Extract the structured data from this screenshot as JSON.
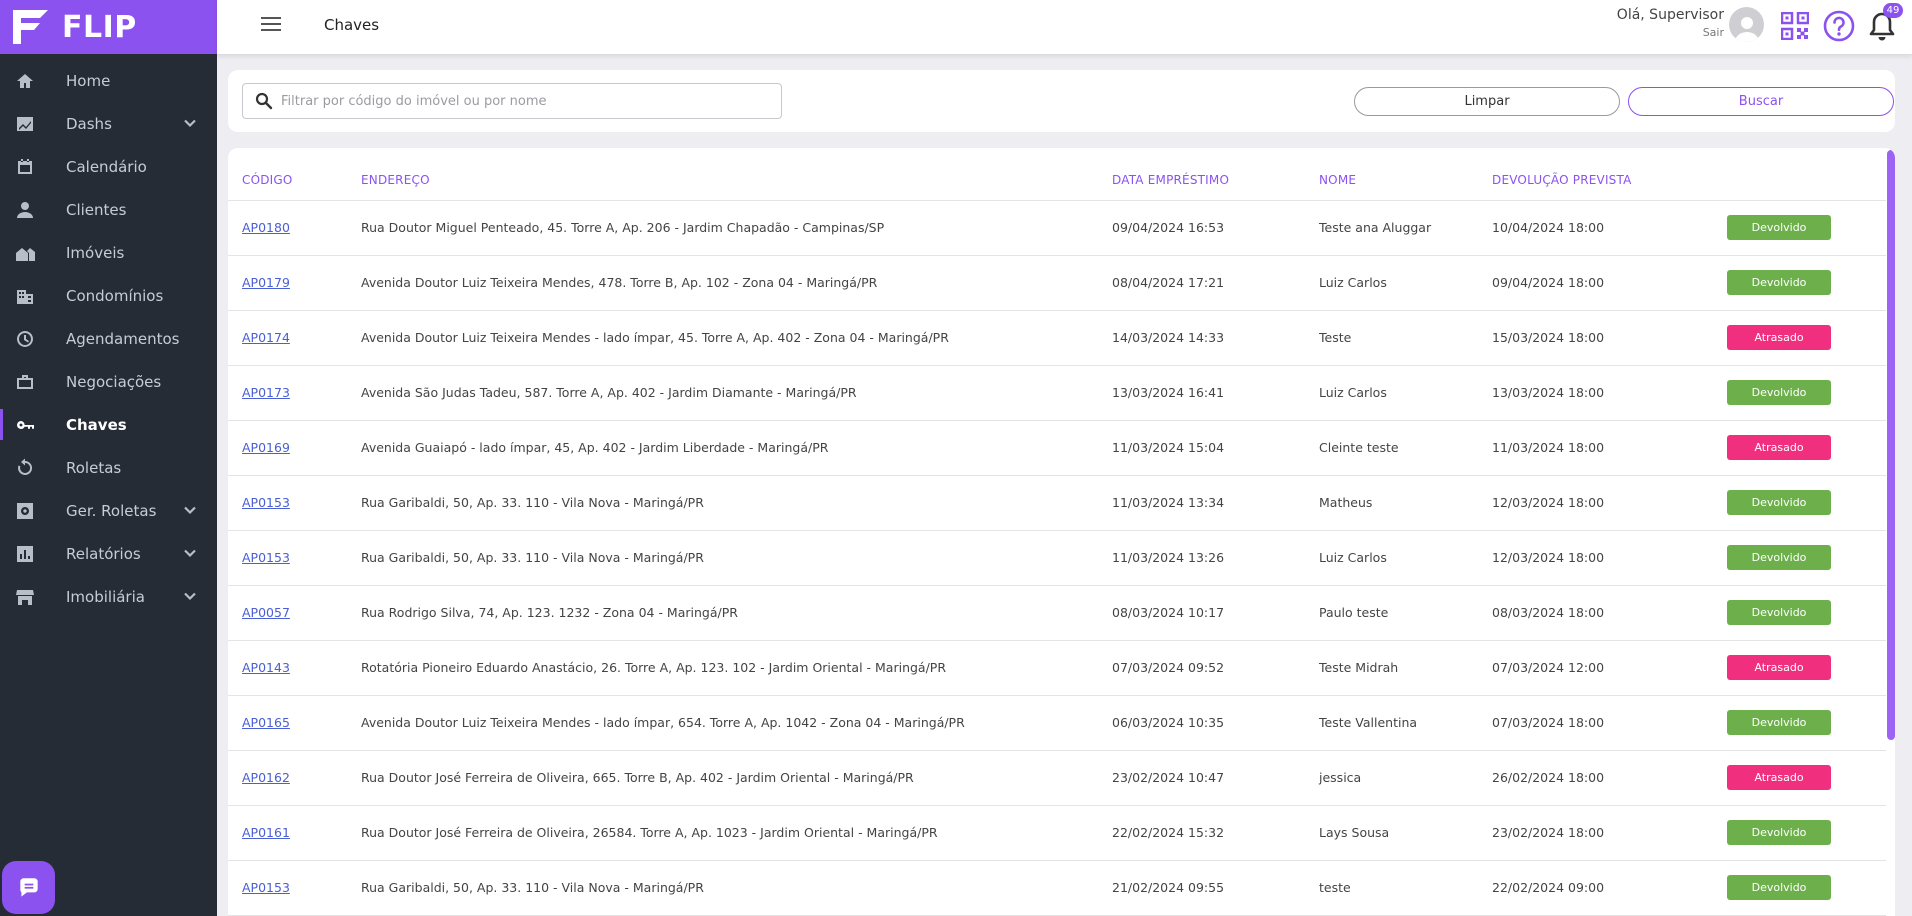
{
  "app": {
    "brand": "FLIP"
  },
  "sidebar": {
    "items": [
      {
        "label": "Home",
        "icon": "home-icon",
        "expandable": false
      },
      {
        "label": "Dashs",
        "icon": "chart-line-icon",
        "expandable": true
      },
      {
        "label": "Calendário",
        "icon": "calendar-icon",
        "expandable": false
      },
      {
        "label": "Clientes",
        "icon": "person-icon",
        "expandable": false
      },
      {
        "label": "Imóveis",
        "icon": "houses-icon",
        "expandable": false
      },
      {
        "label": "Condomínios",
        "icon": "building-icon",
        "expandable": false
      },
      {
        "label": "Agendamentos",
        "icon": "clock-icon",
        "expandable": false
      },
      {
        "label": "Negociações",
        "icon": "briefcase-icon",
        "expandable": false
      },
      {
        "label": "Chaves",
        "icon": "key-icon",
        "expandable": false,
        "active": true
      },
      {
        "label": "Roletas",
        "icon": "rotate-icon",
        "expandable": false
      },
      {
        "label": "Ger. Roletas",
        "icon": "settings-box-icon",
        "expandable": true
      },
      {
        "label": "Relatórios",
        "icon": "bar-chart-icon",
        "expandable": true
      },
      {
        "label": "Imobiliária",
        "icon": "store-icon",
        "expandable": true
      }
    ]
  },
  "topbar": {
    "title": "Chaves",
    "greeting": "Olá, Supervisor",
    "logout": "Sair",
    "notifications": "49"
  },
  "filter": {
    "placeholder": "Filtrar por código do imóvel ou por nome",
    "clear_label": "Limpar",
    "search_label": "Buscar"
  },
  "table": {
    "headers": [
      "CÓDIGO",
      "ENDEREÇO",
      "DATA EMPRÉSTIMO",
      "NOME",
      "DEVOLUÇÃO PREVISTA",
      ""
    ],
    "rows": [
      {
        "code": "AP0180",
        "address": "Rua Doutor Miguel Penteado, 45. Torre A, Ap. 206 - Jardim Chapadão - Campinas/SP",
        "loan_date": "09/04/2024 16:53",
        "name": "Teste ana Aluggar",
        "due_date": "10/04/2024 18:00",
        "status": "Devolvido"
      },
      {
        "code": "AP0179",
        "address": "Avenida Doutor Luiz Teixeira Mendes, 478. Torre B, Ap. 102 - Zona 04 - Maringá/PR",
        "loan_date": "08/04/2024 17:21",
        "name": "Luiz Carlos",
        "due_date": "09/04/2024 18:00",
        "status": "Devolvido"
      },
      {
        "code": "AP0174",
        "address": "Avenida Doutor Luiz Teixeira Mendes - lado ímpar, 45. Torre A, Ap. 402 - Zona 04 - Maringá/PR",
        "loan_date": "14/03/2024 14:33",
        "name": "Teste",
        "due_date": "15/03/2024 18:00",
        "status": "Atrasado"
      },
      {
        "code": "AP0173",
        "address": "Avenida São Judas Tadeu, 587. Torre A, Ap. 402 - Jardim Diamante - Maringá/PR",
        "loan_date": "13/03/2024 16:41",
        "name": "Luiz Carlos",
        "due_date": "13/03/2024 18:00",
        "status": "Devolvido"
      },
      {
        "code": "AP0169",
        "address": "Avenida Guaiapó - lado ímpar, 45, Ap. 402 - Jardim Liberdade - Maringá/PR",
        "loan_date": "11/03/2024 15:04",
        "name": "Cleinte teste",
        "due_date": "11/03/2024 18:00",
        "status": "Atrasado"
      },
      {
        "code": "AP0153",
        "address": "Rua Garibaldi, 50, Ap. 33. 110 - Vila Nova - Maringá/PR",
        "loan_date": "11/03/2024 13:34",
        "name": "Matheus",
        "due_date": "12/03/2024 18:00",
        "status": "Devolvido"
      },
      {
        "code": "AP0153",
        "address": "Rua Garibaldi, 50, Ap. 33. 110 - Vila Nova - Maringá/PR",
        "loan_date": "11/03/2024 13:26",
        "name": "Luiz Carlos",
        "due_date": "12/03/2024 18:00",
        "status": "Devolvido"
      },
      {
        "code": "AP0057",
        "address": "Rua Rodrigo Silva, 74, Ap. 123. 1232 - Zona 04 - Maringá/PR",
        "loan_date": "08/03/2024 10:17",
        "name": "Paulo teste",
        "due_date": "08/03/2024 18:00",
        "status": "Devolvido"
      },
      {
        "code": "AP0143",
        "address": "Rotatória Pioneiro Eduardo Anastácio, 26. Torre A, Ap. 123. 102 - Jardim Oriental - Maringá/PR",
        "loan_date": "07/03/2024 09:52",
        "name": "Teste Midrah",
        "due_date": "07/03/2024 12:00",
        "status": "Atrasado"
      },
      {
        "code": "AP0165",
        "address": "Avenida Doutor Luiz Teixeira Mendes - lado ímpar, 654. Torre A, Ap. 1042 - Zona 04 - Maringá/PR",
        "loan_date": "06/03/2024 10:35",
        "name": "Teste Vallentina",
        "due_date": "07/03/2024 18:00",
        "status": "Devolvido"
      },
      {
        "code": "AP0162",
        "address": "Rua Doutor José Ferreira de Oliveira, 665. Torre B, Ap. 402 - Jardim Oriental - Maringá/PR",
        "loan_date": "23/02/2024 10:47",
        "name": "jessica",
        "due_date": "26/02/2024 18:00",
        "status": "Atrasado"
      },
      {
        "code": "AP0161",
        "address": "Rua Doutor José Ferreira de Oliveira, 26584. Torre A, Ap. 1023 - Jardim Oriental - Maringá/PR",
        "loan_date": "22/02/2024 15:32",
        "name": "Lays Sousa",
        "due_date": "23/02/2024 18:00",
        "status": "Devolvido"
      },
      {
        "code": "AP0153",
        "address": "Rua Garibaldi, 50, Ap. 33. 110 - Vila Nova - Maringá/PR",
        "loan_date": "21/02/2024 09:55",
        "name": "teste",
        "due_date": "22/02/2024 09:00",
        "status": "Devolvido"
      }
    ]
  },
  "colors": {
    "accent": "#8c52f0",
    "sidebar_bg": "#262c36",
    "returned": "#6db04b",
    "late": "#f0307e",
    "link": "#4a5fd3"
  }
}
